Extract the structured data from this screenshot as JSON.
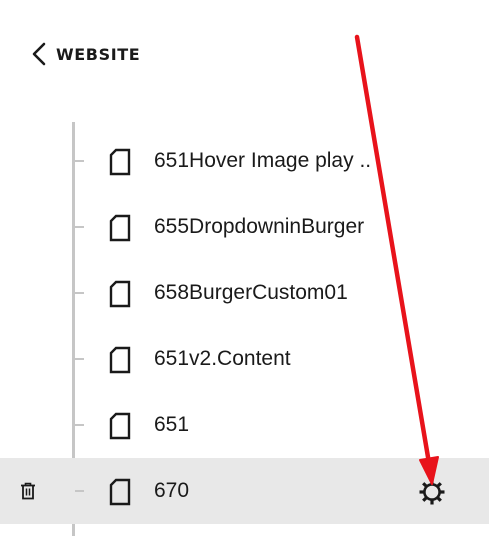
{
  "header": {
    "back_label": "WEBSITE"
  },
  "pages": [
    {
      "title": "651Hover Image play ..",
      "icon": "page-icon",
      "selected": false
    },
    {
      "title": "655DropdowninBurger",
      "icon": "page-icon",
      "selected": false
    },
    {
      "title": "658BurgerCustom01",
      "icon": "page-icon",
      "selected": false
    },
    {
      "title": "651v2.Content",
      "icon": "page-icon",
      "selected": false
    },
    {
      "title": "651",
      "icon": "page-icon",
      "selected": false
    },
    {
      "title": "670",
      "icon": "page-icon",
      "selected": true
    }
  ],
  "selected_actions": {
    "delete_icon": "trash-icon",
    "settings_icon": "gear-icon"
  },
  "colors": {
    "text": "#1a1a1a",
    "tree_line": "#c6c6c6",
    "selected_row": "#e8e8e8",
    "annotation_arrow": "#e8131b"
  }
}
